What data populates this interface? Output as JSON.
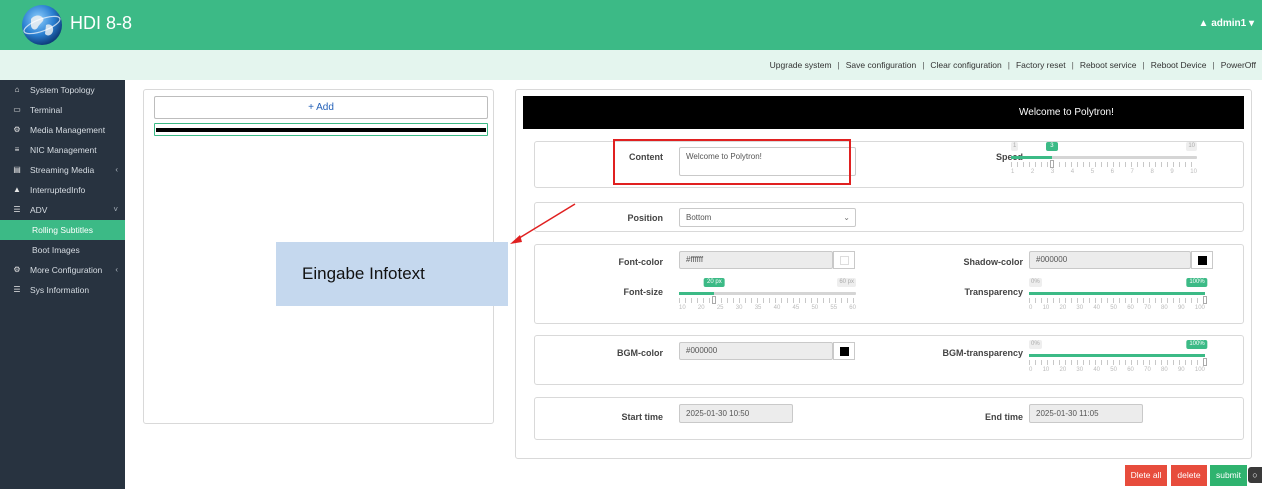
{
  "header": {
    "app_title": "HDI 8-8",
    "user_label": "▲ admin1 ▾"
  },
  "actions": [
    "Upgrade system",
    "Save configuration",
    "Clear configuration",
    "Factory reset",
    "Reboot service",
    "Reboot Device",
    "PowerOff"
  ],
  "sidebar": {
    "items": [
      {
        "label": "System Topology",
        "icon": "home-icon",
        "glyph": "⌂"
      },
      {
        "label": "Terminal",
        "icon": "monitor-icon",
        "glyph": "▭"
      },
      {
        "label": "Media Management",
        "icon": "gear-icon",
        "glyph": "⚙"
      },
      {
        "label": "NIC Management",
        "icon": "rss-icon",
        "glyph": "≡"
      },
      {
        "label": "Streaming Media",
        "icon": "film-icon",
        "glyph": "▤",
        "chevron": "‹"
      },
      {
        "label": "InterruptedInfo",
        "icon": "bell-icon",
        "glyph": "▲"
      },
      {
        "label": "ADV",
        "icon": "list-icon",
        "glyph": "☰",
        "chevron": "˅"
      },
      {
        "label": "Rolling Subtitles",
        "sub": true,
        "active": true
      },
      {
        "label": "Boot Images",
        "sub": true
      },
      {
        "label": "More Configuration",
        "icon": "cogs-icon",
        "glyph": "⚙",
        "chevron": "‹"
      },
      {
        "label": "Sys Information",
        "icon": "info-icon",
        "glyph": "☰"
      }
    ]
  },
  "left_panel": {
    "add_label": "+ Add"
  },
  "preview": {
    "text": "Welcome to Polytron!"
  },
  "form": {
    "content_label": "Content",
    "content_value": "Welcome to Polytron!",
    "speed_label": "Speed",
    "speed_value": "3",
    "speed_min": "1",
    "speed_max": "10",
    "speed_fraction": 0.22,
    "speed_ticks": [
      "1",
      "2",
      "3",
      "4",
      "5",
      "6",
      "7",
      "8",
      "9",
      "10"
    ],
    "position_label": "Position",
    "position_value": "Bottom",
    "font_color_label": "Font-color",
    "font_color_value": "#ffffff",
    "shadow_color_label": "Shadow-color",
    "shadow_color_value": "#000000",
    "font_size_label": "Font-size",
    "font_size_value": "20 px",
    "font_size_min": "10",
    "font_size_max": "60 px",
    "font_size_fraction": 0.2,
    "font_size_ticks": [
      "10",
      "20",
      "25",
      "30",
      "35",
      "40",
      "45",
      "50",
      "55",
      "60"
    ],
    "transparency_label": "Transparency",
    "transparency_value": "100%",
    "transparency_min": "0%",
    "transparency_fraction": 1.0,
    "transparency_ticks": [
      "0",
      "10",
      "20",
      "30",
      "40",
      "50",
      "60",
      "70",
      "80",
      "90",
      "100"
    ],
    "bgm_color_label": "BGM-color",
    "bgm_color_value": "#000000",
    "bgm_transparency_label": "BGM-transparency",
    "bgm_transparency_value": "100%",
    "bgm_transparency_min": "0%",
    "bgm_transparency_fraction": 1.0,
    "start_time_label": "Start time",
    "start_time_value": "2025-01-30 10:50",
    "end_time_label": "End time",
    "end_time_value": "2025-01-30 11:05"
  },
  "annotation": {
    "callout_text": "Eingabe Infotext"
  },
  "buttons": {
    "delete_all": "Dlete all",
    "delete": "delete",
    "submit": "submit"
  },
  "colors": {
    "accent": "#3cba86",
    "sidebar_bg": "#283340",
    "danger": "#e74c3c",
    "annotation_red": "#e02020",
    "callout_bg": "#c5d8ee"
  }
}
